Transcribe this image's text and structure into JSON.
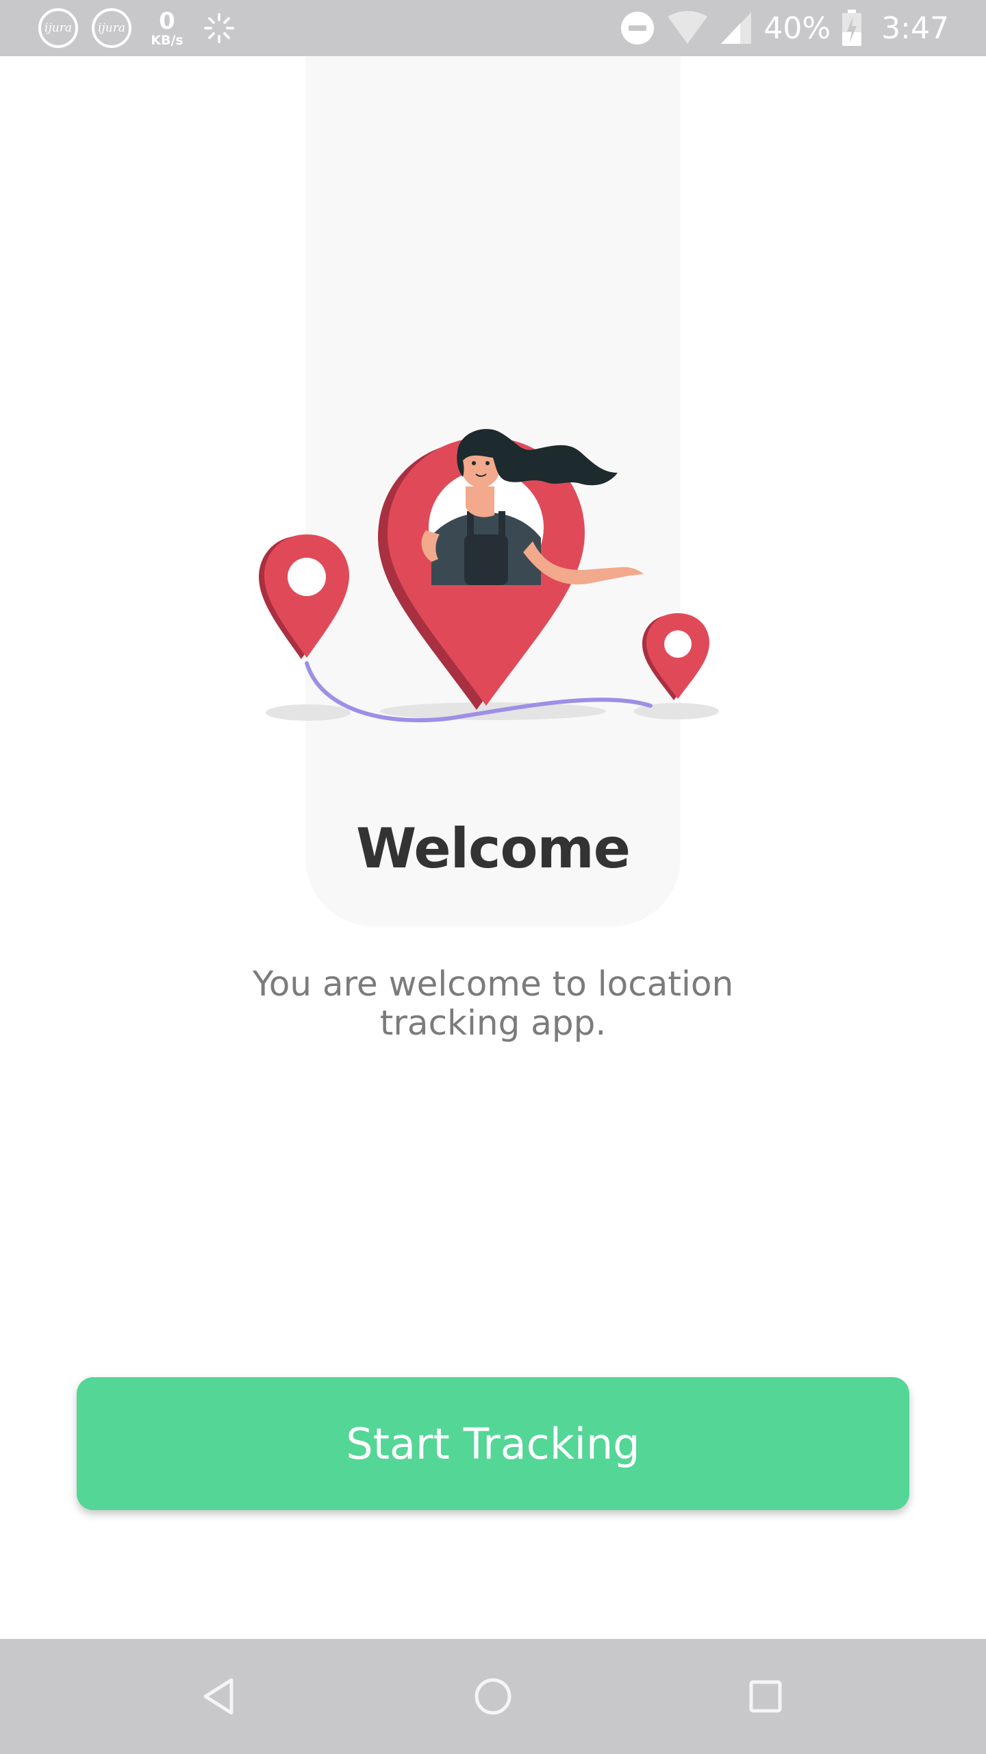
{
  "status_bar": {
    "app_badges": [
      "ijura",
      "ijura"
    ],
    "net_speed_value": "0",
    "net_speed_unit": "KB/s",
    "battery_percent": "40%",
    "time": "3:47"
  },
  "welcome": {
    "title": "Welcome",
    "subtitle": "You are welcome to location tracking app."
  },
  "actions": {
    "start_label": "Start Tracking"
  },
  "colors": {
    "accent": "#53d696",
    "pin": "#e04a58",
    "route": "#9d8fe6",
    "status_bar": "#c8c7c9"
  },
  "icons": {
    "illustration": "location-pins-woman-illustration",
    "nav_back": "back-triangle-icon",
    "nav_home": "home-circle-icon",
    "nav_recents": "recents-square-icon"
  }
}
